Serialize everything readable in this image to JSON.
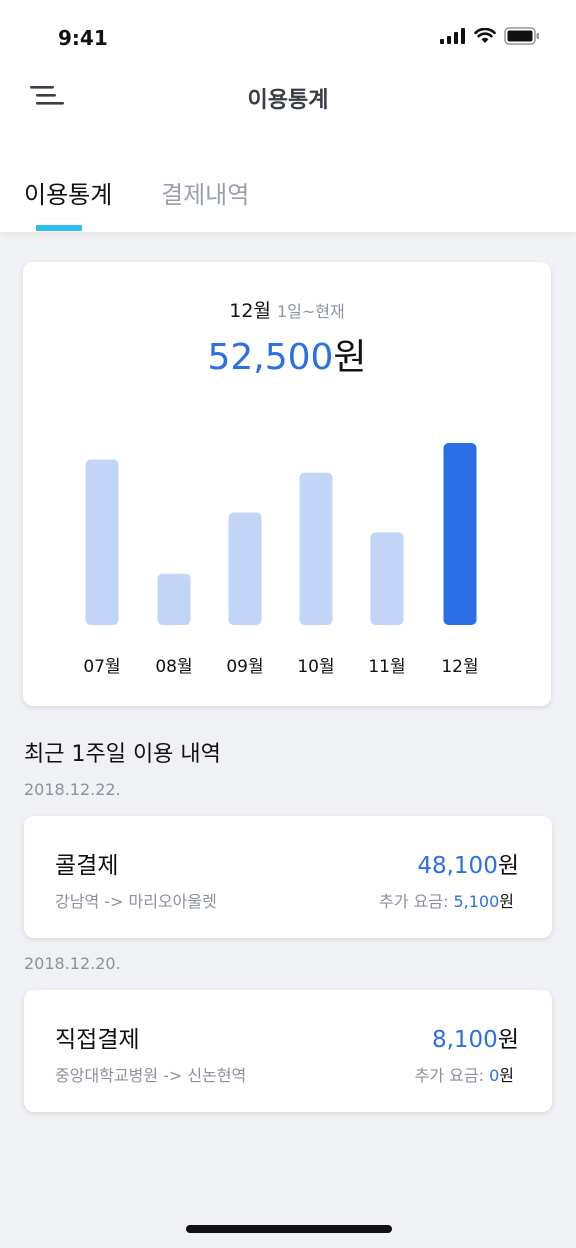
{
  "status": {
    "time": "9:41"
  },
  "nav": {
    "title": "이용통계"
  },
  "tabs": [
    {
      "label": "이용통계",
      "active": true
    },
    {
      "label": "결제내역",
      "active": false
    }
  ],
  "summary": {
    "month": "12월",
    "range": "1일~현재",
    "amount": "52,500",
    "unit": "원"
  },
  "chart_data": {
    "type": "bar",
    "categories": [
      "07월",
      "08월",
      "09월",
      "10월",
      "11월",
      "12월"
    ],
    "values": [
      100,
      31,
      68,
      92,
      56,
      110
    ],
    "highlight_index": 5,
    "colors": {
      "normal": "#c2d5f7",
      "highlight": "#2b6fe6"
    }
  },
  "recent": {
    "title": "최근 1주일 이용 내역",
    "groups": [
      {
        "date": "2018.12.22.",
        "name": "콜결제",
        "route": "강남역 -> 마리오아울렛",
        "amount": "48,100",
        "amount_unit": "원",
        "extra_label": "추가 요금: ",
        "extra_amount": "5,100",
        "extra_unit": "원"
      },
      {
        "date": "2018.12.20.",
        "name": "직접결제",
        "route": "중앙대학교병원 -> 신논현역",
        "amount": "8,100",
        "amount_unit": "원",
        "extra_label": "추가 요금: ",
        "extra_amount": "0",
        "extra_unit": "원"
      }
    ]
  }
}
